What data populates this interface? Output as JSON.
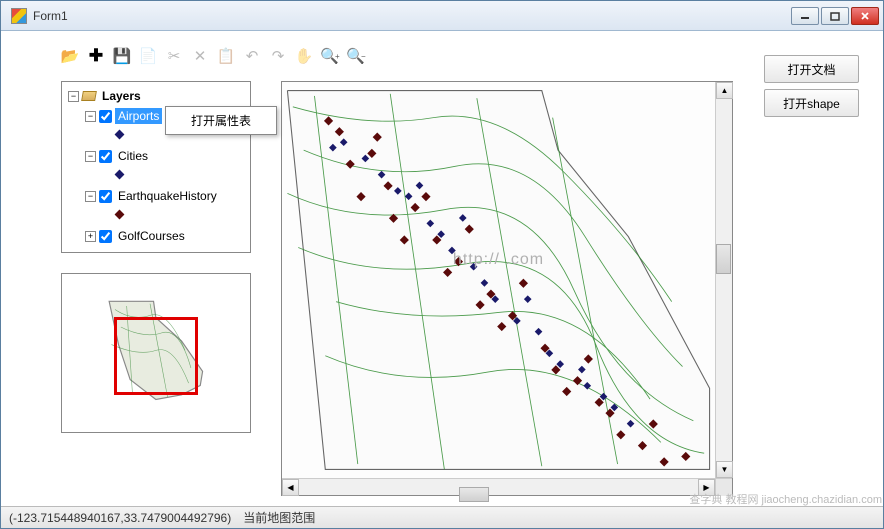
{
  "titlebar": {
    "title": "Form1"
  },
  "toolbar": {
    "icons": [
      "open",
      "add",
      "save",
      "copy",
      "cut",
      "clipboard",
      "paste",
      "undo",
      "redo",
      "pan",
      "zoom-in",
      "zoom-out"
    ]
  },
  "actions": {
    "open_doc": "打开文档",
    "open_shape": "打开shape"
  },
  "layers_tree": {
    "root_label": "Layers",
    "items": [
      {
        "label": "Airports",
        "legend_color": "navy",
        "selected": true
      },
      {
        "label": "Cities",
        "legend_color": "navy"
      },
      {
        "label": "EarthquakeHistory",
        "legend_color": "darkred"
      },
      {
        "label": "GolfCourses",
        "legend_color": "darkred"
      }
    ]
  },
  "context_menu": {
    "item1": "打开属性表"
  },
  "map": {
    "watermark": "http://            .com"
  },
  "status": {
    "coords": "(-123.715448940167,33.7479004492796)",
    "label": "当前地图范围"
  },
  "corner_watermark": "查字典  教程网  jiaocheng.chazidian.com"
}
